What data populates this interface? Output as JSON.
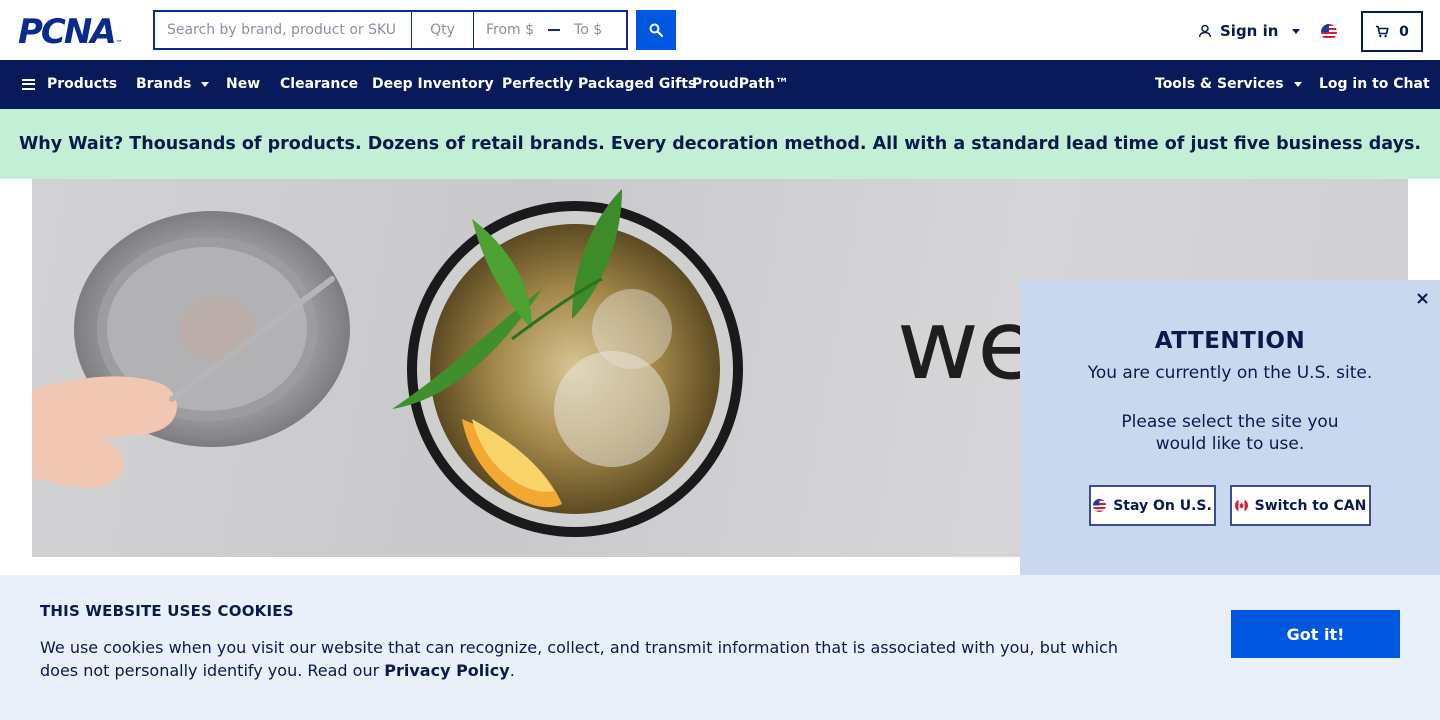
{
  "header": {
    "logo_text": "PCNA",
    "logo_tm": "™",
    "search": {
      "placeholder": "Search by brand, product or SKU"
    },
    "qty": {
      "placeholder": "Qty"
    },
    "price": {
      "from_label": "From $",
      "to_label": "To $"
    },
    "sign_in_label": "Sign in",
    "cart_count": "0"
  },
  "nav": {
    "products": "Products",
    "brands": "Brands",
    "new": "New",
    "clearance": "Clearance",
    "deep_inventory": "Deep Inventory",
    "gifts": "Perfectly Packaged Gifts",
    "proudpath": "ProudPath™",
    "tools": "Tools & Services",
    "chat": "Log in to Chat"
  },
  "promo": {
    "text": "Why Wait? Thousands of products. Dozens of retail brands. Every decoration method. All with a standard lead time of just five business days."
  },
  "hero": {
    "partial_word": "we"
  },
  "region_modal": {
    "title": "ATTENTION",
    "line1": "You are currently on the U.S. site.",
    "line2": "Please select the site you",
    "line3": "would like to use.",
    "stay_label": "Stay On U.S.",
    "switch_label": "Switch to CAN"
  },
  "cookie": {
    "title": "THIS WEBSITE USES COOKIES",
    "text": "We use cookies when you visit our website that can recognize, collect, and transmit information that is associated with you, but which does not personally identify you. Read our ",
    "link": "Privacy Policy",
    "period": ".",
    "button": "Got it!"
  },
  "colors": {
    "navy": "#081a59",
    "brand_blue": "#0057e0",
    "promo_green": "#c2efd6",
    "modal_bg": "#c9d8ef",
    "cookie_bg": "#e9f0fa"
  },
  "icons": [
    "search-icon",
    "user-icon",
    "us-flag-icon",
    "cart-icon",
    "menu-icon",
    "close-icon",
    "canada-flag-icon"
  ]
}
